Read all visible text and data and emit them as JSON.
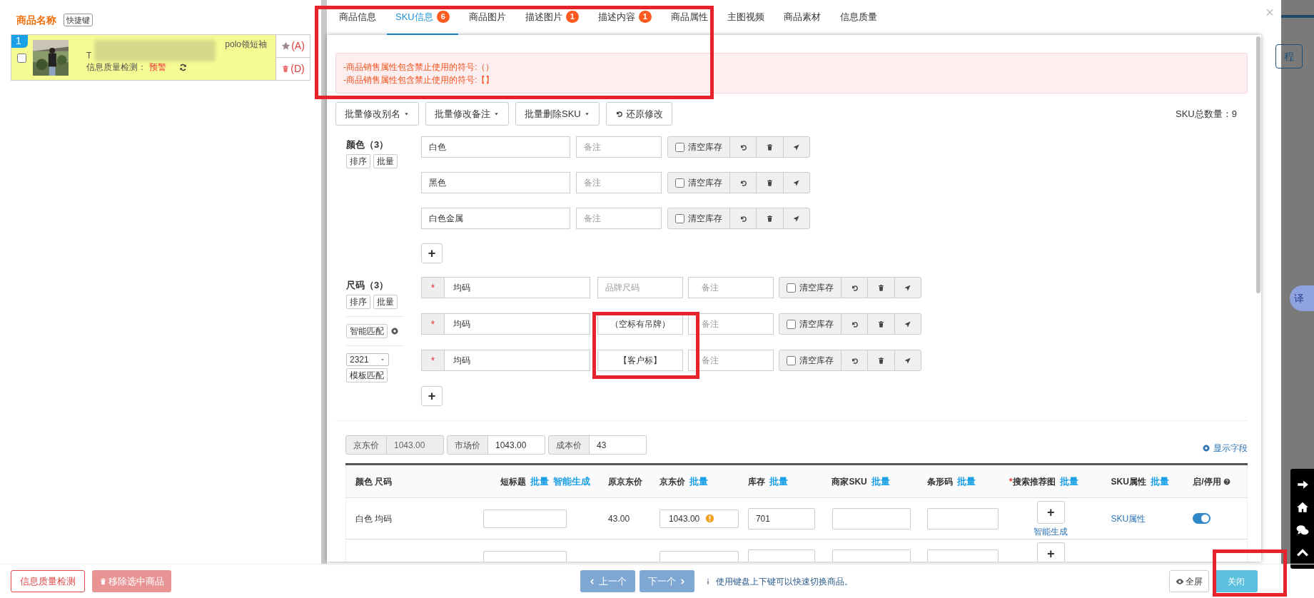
{
  "sidebar": {
    "title": "商品名称",
    "shortcut_button": "快捷键",
    "products": [
      {
        "index": "1",
        "checked": false,
        "title_fragments": [
          "polo领短袖",
          "T"
        ],
        "quality_label": "信息质量检测：",
        "quality_status": "预警",
        "favorite_key": "(A)",
        "delete_key": "(D)"
      }
    ]
  },
  "tabs": [
    {
      "label": "商品信息",
      "selected": false
    },
    {
      "label": "SKU信息",
      "badge": "6",
      "selected": true
    },
    {
      "label": "商品图片",
      "selected": false
    },
    {
      "label": "描述图片",
      "badge": "1",
      "selected": false
    },
    {
      "label": "描述内容",
      "badge": "1",
      "selected": false
    },
    {
      "label": "商品属性",
      "selected": false
    },
    {
      "label": "主图视频",
      "selected": false
    },
    {
      "label": "商品素材",
      "selected": false
    },
    {
      "label": "信息质量",
      "selected": false
    }
  ],
  "alerts": [
    "-商品销售属性包含禁止使用的符号:（）",
    "-商品销售属性包含禁止使用的符号:【】"
  ],
  "toolbar": {
    "buttons": [
      {
        "label": "批量修改别名",
        "kind": "dropdown"
      },
      {
        "label": "批量修改备注",
        "kind": "dropdown"
      },
      {
        "label": "批量删除SKU",
        "kind": "dropdown"
      },
      {
        "label": "还原修改",
        "kind": "undo"
      }
    ],
    "sku_count": "SKU总数量：9"
  },
  "attributes": [
    {
      "kind": "color",
      "title": "颜色（3）",
      "sort": "排序",
      "batch": "批量",
      "add": "+",
      "values": [
        {
          "value": "白色",
          "note_placeholder": "备注",
          "clear_stock": "清空库存",
          "checked": false
        },
        {
          "value": "黑色",
          "note_placeholder": "备注",
          "clear_stock": "清空库存",
          "checked": false
        },
        {
          "value": "白色金属",
          "note_placeholder": "备注",
          "clear_stock": "清空库存",
          "checked": false
        }
      ]
    },
    {
      "kind": "size",
      "title": "尺码（3）",
      "sort": "排序",
      "batch": "批量",
      "smart_match": "智能匹配",
      "template_select": "2321",
      "template_match": "模板匹配",
      "add": "+",
      "values": [
        {
          "required_mark": "*",
          "value": "均码",
          "brand_size_placeholder": "品牌尺码",
          "note_placeholder": "备注",
          "clear_stock": "清空库存",
          "checked": false
        },
        {
          "required_mark": "*",
          "value": "均码",
          "brand_size": "（空标有吊牌）",
          "note_placeholder": "备注",
          "clear_stock": "清空库存",
          "checked": false
        },
        {
          "required_mark": "*",
          "value": "均码",
          "brand_size": "【客户标】",
          "note_placeholder": "备注",
          "clear_stock": "清空库存",
          "checked": false
        }
      ]
    }
  ],
  "prices": [
    {
      "label": "京东价",
      "value": "1043.00",
      "disabled": true
    },
    {
      "label": "市场价",
      "value": "1043.00",
      "disabled": false
    },
    {
      "label": "成本价",
      "value": "43",
      "disabled": false
    }
  ],
  "show_fields": "显示字段",
  "table": {
    "columns": [
      {
        "label": "颜色 尺码"
      },
      {
        "label": "短标题",
        "links": [
          "批量",
          "智能生成"
        ]
      },
      {
        "label": "原京东价"
      },
      {
        "label": "京东价",
        "links": [
          "批量"
        ]
      },
      {
        "label": "库存",
        "links": [
          "批量"
        ]
      },
      {
        "label": "商家SKU",
        "links": [
          "批量"
        ]
      },
      {
        "label": "条形码",
        "links": [
          "批量"
        ]
      },
      {
        "label": "搜索推荐图",
        "required_mark": "*",
        "links": [
          "批量"
        ]
      },
      {
        "label": "SKU属性",
        "links": [
          "批量"
        ]
      },
      {
        "label": "启/停用",
        "help": true
      }
    ],
    "rows": [
      {
        "name": "白色 均码",
        "original_price": "43.00",
        "jd_price": "1043.00",
        "price_warning": true,
        "stock": "701",
        "image_button": "+",
        "image_link": "智能生成",
        "sku_attr": "SKU属性",
        "enabled": true
      },
      {
        "image_button": "+"
      }
    ]
  },
  "footer": {
    "quality_check": "信息质量检测",
    "remove_selected": "移除选中商品",
    "prev": "上一个",
    "next": "下一个",
    "hint": "使用键盘上下键可以快速切换商品。",
    "fullscreen": "全屏",
    "close": "关闭"
  },
  "background": {
    "button": "程",
    "translate": "译"
  },
  "close_icon": "×"
}
